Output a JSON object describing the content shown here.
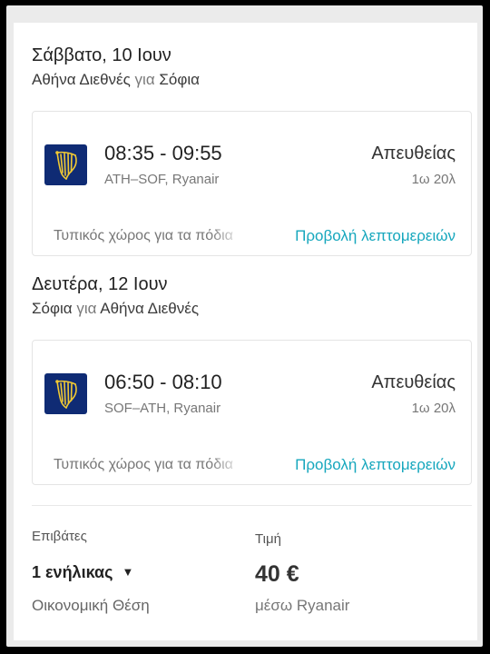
{
  "outbound": {
    "date": "Σάββατο, 10 Ιουν",
    "from": "Αθήνα Διεθνές",
    "connector": "για",
    "to": "Σόφια",
    "times": "08:35 - 09:55",
    "route": "ATH–SOF, Ryanair",
    "stops": "Απευθείας",
    "duration": "1ω 20λ",
    "seat_info": "Τυπικός χώρος για τα πόδια",
    "details_link": "Προβολή λεπτομερειών",
    "airline_icon": "ryanair-harp-icon"
  },
  "return": {
    "date": "Δευτέρα, 12 Ιουν",
    "from": "Σόφια",
    "connector": "για",
    "to": "Αθήνα Διεθνές",
    "times": "06:50 - 08:10",
    "route": "SOF–ATH, Ryanair",
    "stops": "Απευθείας",
    "duration": "1ω 20λ",
    "seat_info": "Τυπικός χώρος για τα πόδια",
    "details_link": "Προβολή λεπτομερειών",
    "airline_icon": "ryanair-harp-icon"
  },
  "booking": {
    "passengers_label": "Επιβάτες",
    "passengers_value": "1 ενήλικας",
    "caret": "▼",
    "cabin": "Οικονομική Θέση",
    "price_label": "Τιμή",
    "price": "40 €",
    "via": "μέσω Ryanair"
  },
  "colors": {
    "accent_link": "#16a7bd",
    "logo_bg": "#0f2b74",
    "logo_fg": "#f1c933"
  }
}
